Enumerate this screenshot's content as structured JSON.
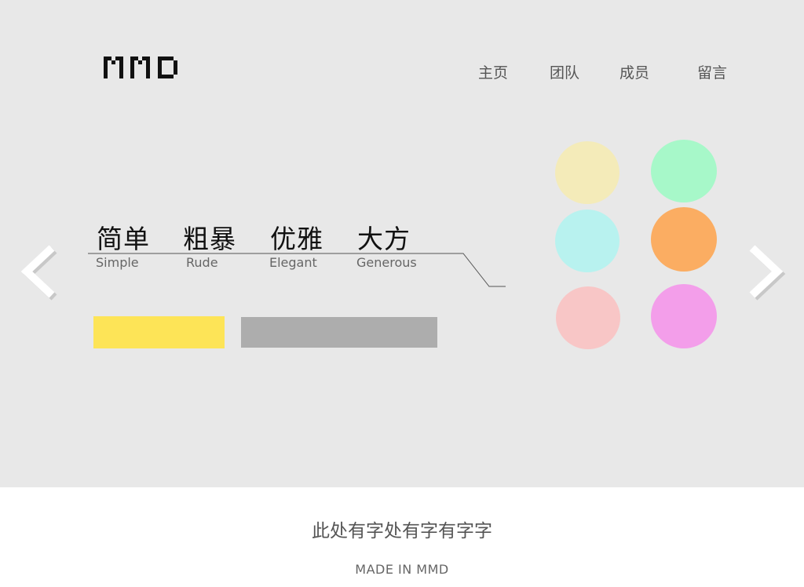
{
  "brand": {
    "logo_text": "MMD"
  },
  "nav": {
    "items": [
      "主页",
      "团队",
      "成员",
      "留言"
    ]
  },
  "slogans": [
    {
      "cn": "简单",
      "en": "Simple"
    },
    {
      "cn": "粗暴",
      "en": "Rude"
    },
    {
      "cn": "优雅",
      "en": "Elegant"
    },
    {
      "cn": "大方",
      "en": "Generous"
    }
  ],
  "carousel": {
    "prev_icon": "chevron-left-icon",
    "next_icon": "chevron-right-icon"
  },
  "buttons": {
    "primary_color": "#fde457",
    "secondary_color": "#adadad"
  },
  "color_dots": [
    {
      "color": "#f4ebb9"
    },
    {
      "color": "#a7f8c9"
    },
    {
      "color": "#b8f2ef"
    },
    {
      "color": "#fbad62"
    },
    {
      "color": "#f8c6c6"
    },
    {
      "color": "#f39eea"
    }
  ],
  "footer": {
    "text": "此处有字处有字有字字",
    "credit": "MADE IN MMD"
  }
}
